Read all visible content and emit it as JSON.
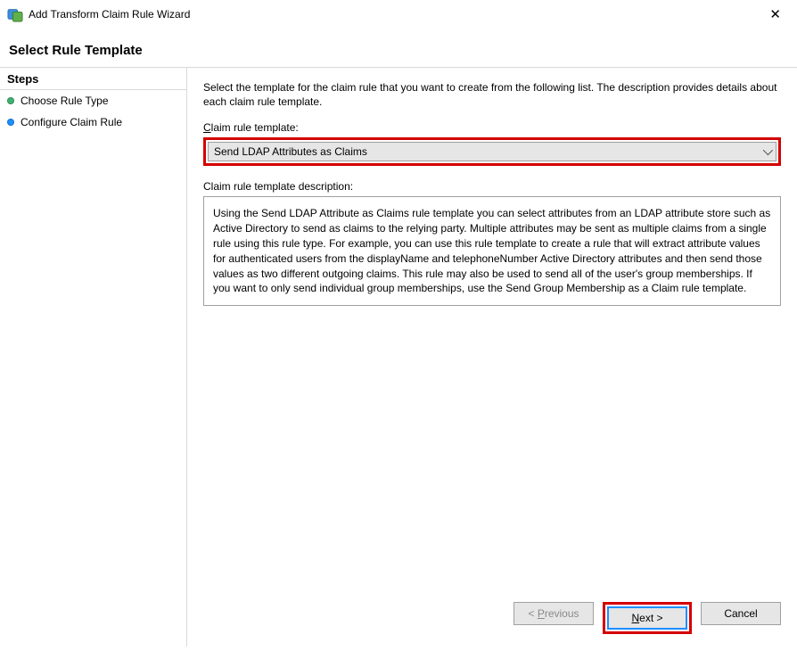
{
  "titleBar": {
    "title": "Add Transform Claim Rule Wizard"
  },
  "heading": "Select Rule Template",
  "sidebar": {
    "header": "Steps",
    "items": [
      {
        "label": "Choose Rule Type",
        "bullet": "green"
      },
      {
        "label": "Configure Claim Rule",
        "bullet": "blue"
      }
    ]
  },
  "main": {
    "instructions": "Select the template for the claim rule that you want to create from the following list. The description provides details about each claim rule template.",
    "templateLabel_pre": "",
    "templateLabel_u": "C",
    "templateLabel_post": "laim rule template:",
    "templateDropdown": {
      "selected": "Send LDAP Attributes as Claims"
    },
    "descriptionLabel": "Claim rule template description:",
    "descriptionText": "Using the Send LDAP Attribute as Claims rule template you can select attributes from an LDAP attribute store such as Active Directory to send as claims to the relying party. Multiple attributes may be sent as multiple claims from a single rule using this rule type. For example, you can use this rule template to create a rule that will extract attribute values for authenticated users from the displayName and telephoneNumber Active Directory attributes and then send those values as two different outgoing claims. This rule may also be used to send all of the user's group memberships. If you want to only send individual group memberships, use the Send Group Membership as a Claim rule template."
  },
  "buttons": {
    "prev_pre": "< ",
    "prev_u": "P",
    "prev_post": "revious",
    "next_u": "N",
    "next_post": "ext >",
    "cancel": "Cancel"
  }
}
